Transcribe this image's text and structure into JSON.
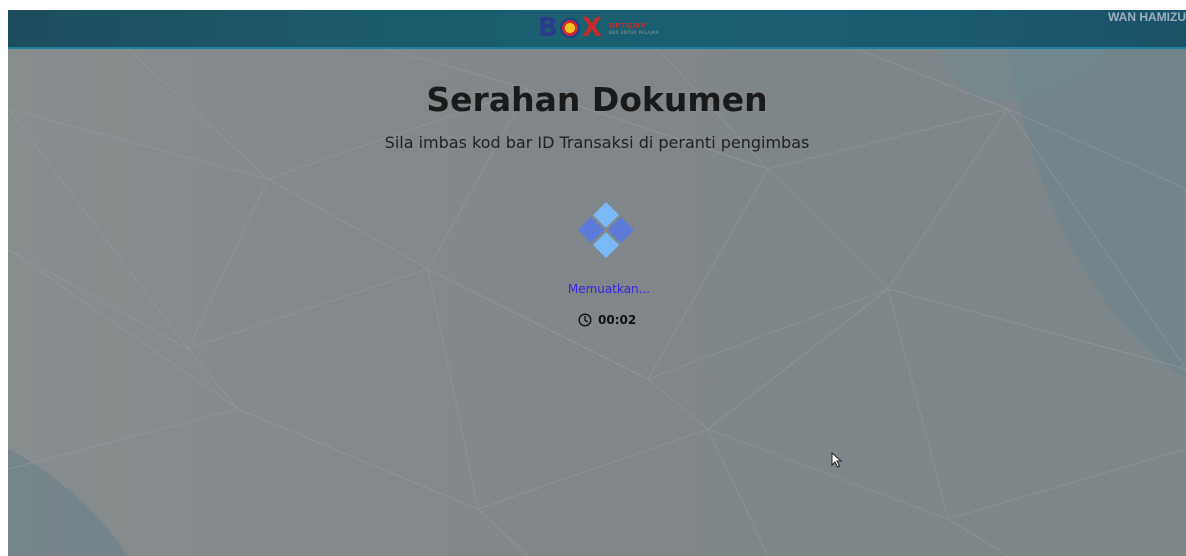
{
  "header": {
    "logo": {
      "name": "box-logo",
      "letters": [
        "B",
        "X"
      ],
      "tagline_primary": "DPTGWP",
      "tagline_secondary": "BOX UNTUK PELAJAR"
    },
    "username": "WAN HAMIZU"
  },
  "main": {
    "title": "Serahan Dokumen",
    "subtitle": "Sila imbas kod bar ID Transaksi di peranti pengimbas",
    "loading_text": "Memuatkan...",
    "timer": "00:02",
    "icons": {
      "spinner": "diamond-spinner-icon",
      "timer": "clock-icon",
      "cursor": "mouse-cursor-icon"
    }
  },
  "colors": {
    "header": "#1a6070",
    "background_overlay": "#7f8587",
    "loading_text": "#3b22ee",
    "spinner_light": "#7bb8f7",
    "spinner_dark": "#5b7ad9"
  }
}
